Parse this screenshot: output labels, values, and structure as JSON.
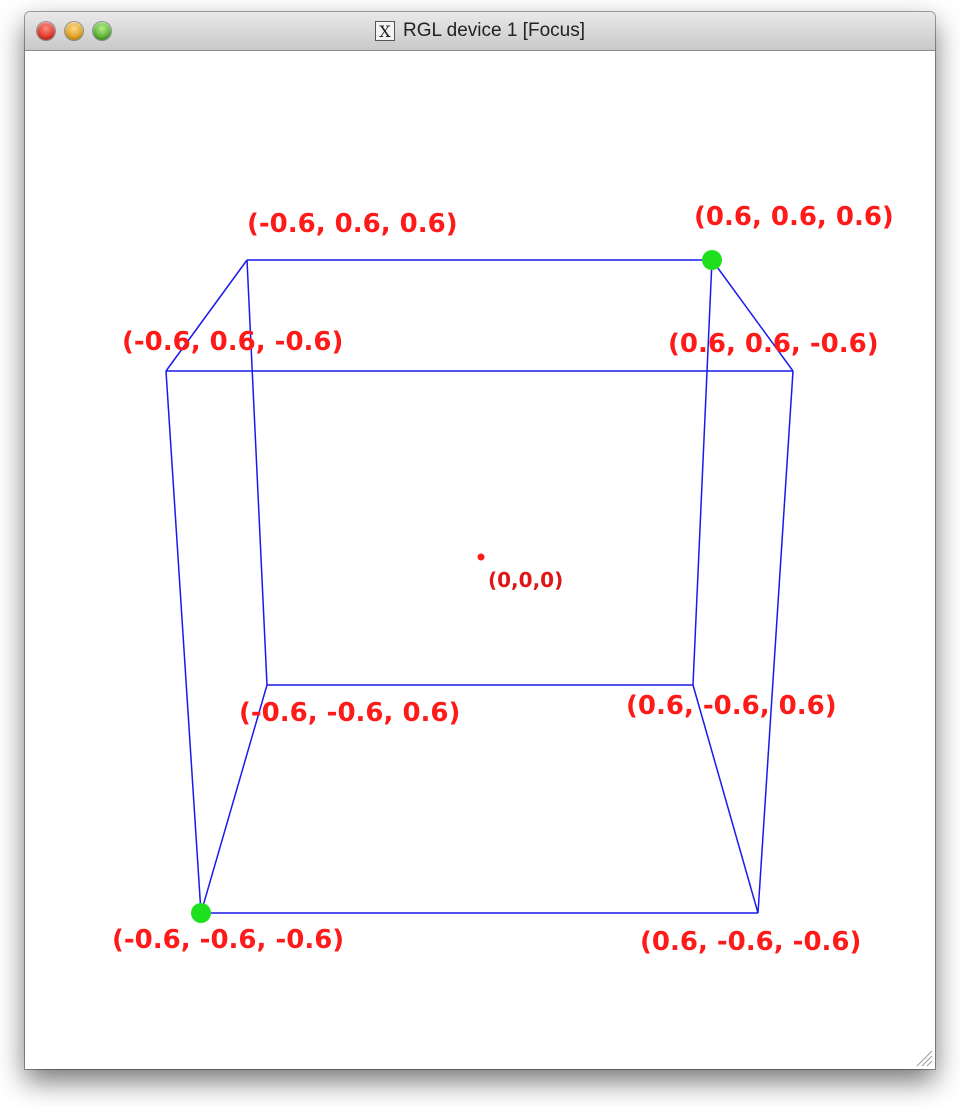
{
  "window": {
    "title": "RGL device 1 [Focus]",
    "icon": "x11-icon",
    "icon_glyph": "X"
  },
  "scene": {
    "edge_color": "#1a1aee",
    "label_color": "#ff1a1a",
    "marker_color": "#1fe01f",
    "origin_label": "(0,0,0)",
    "vertices": [
      {
        "id": "nnn",
        "label": "(-0.6, -0.6, -0.6)",
        "highlighted": true
      },
      {
        "id": "pnn",
        "label": "(0.6, -0.6, -0.6)",
        "highlighted": false
      },
      {
        "id": "npn",
        "label": "(-0.6, 0.6, -0.6)",
        "highlighted": false
      },
      {
        "id": "ppn",
        "label": "(0.6, 0.6, -0.6)",
        "highlighted": false
      },
      {
        "id": "nnp",
        "label": "(-0.6, -0.6, 0.6)",
        "highlighted": false
      },
      {
        "id": "pnp",
        "label": "(0.6, -0.6, 0.6)",
        "highlighted": false
      },
      {
        "id": "npp",
        "label": "(-0.6, 0.6, 0.6)",
        "highlighted": false
      },
      {
        "id": "ppp",
        "label": "(0.6, 0.6, 0.6)",
        "highlighted": true
      }
    ]
  }
}
